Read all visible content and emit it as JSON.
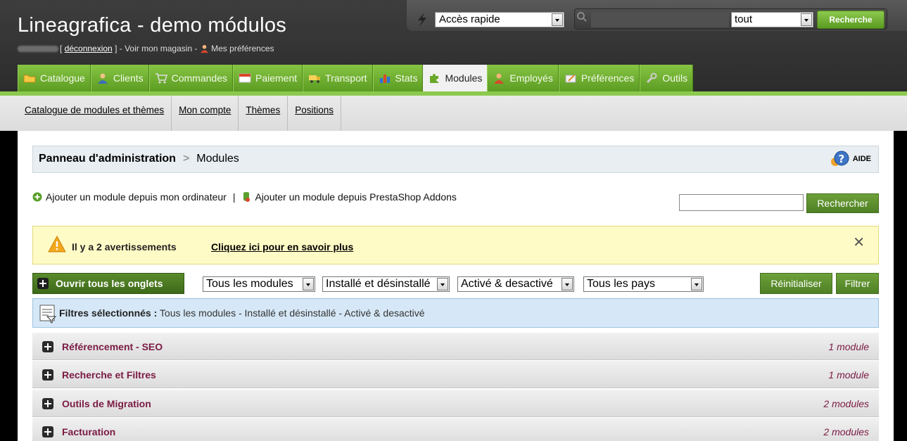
{
  "header": {
    "site_title": "Lineagrafica - demo módulos",
    "logout_link": "déconnexion",
    "shop_link": "] - Voir mon magasin -",
    "preferences_link": "Mes préférences",
    "quick_access": "Accès rapide",
    "search_scope": "tout",
    "search_button": "Recherche"
  },
  "tabs": [
    {
      "label": "Catalogue"
    },
    {
      "label": "Clients"
    },
    {
      "label": "Commandes"
    },
    {
      "label": "Paiement"
    },
    {
      "label": "Transport"
    },
    {
      "label": "Stats"
    },
    {
      "label": "Modules"
    },
    {
      "label": "Employés"
    },
    {
      "label": "Préférences"
    },
    {
      "label": "Outils"
    }
  ],
  "subnav": [
    {
      "label": "Catalogue de modules et thèmes"
    },
    {
      "label": "Mon compte"
    },
    {
      "label": "Thèmes"
    },
    {
      "label": "Positions"
    }
  ],
  "breadcrumb": {
    "root": "Panneau d'administration",
    "current": "Modules",
    "help": "AIDE"
  },
  "add_actions": {
    "from_computer": "Ajouter un module depuis mon ordinateur",
    "separator": "|",
    "from_addons": "Ajouter un module depuis PrestaShop Addons",
    "search_button": "Rechercher"
  },
  "warning": {
    "text": "Il y a 2 avertissements",
    "link": "Cliquez ici pour en savoir plus"
  },
  "toolbar": {
    "open_all": "Ouvrir tous les onglets",
    "filter_type": "Tous les modules",
    "filter_install": "Installé et désinstallé",
    "filter_active": "Activé & desactivé",
    "filter_country": "Tous les pays",
    "reset": "Réinitialiser",
    "apply": "Filtrer"
  },
  "selected_filters": {
    "label": "Filtres sélectionnés :",
    "value": "Tous les modules - Installé et désinstallé - Activé & desactivé"
  },
  "categories": [
    {
      "name": "Référencement - SEO",
      "count": "1 module"
    },
    {
      "name": "Recherche et Filtres",
      "count": "1 module"
    },
    {
      "name": "Outils de Migration",
      "count": "2 modules"
    },
    {
      "name": "Facturation",
      "count": "2 modules"
    }
  ],
  "colors": {
    "accent_green": "#8cc94f",
    "category_text": "#7a1b44",
    "warning_bg": "#fffbc6",
    "filters_bg": "#d6e8f7"
  }
}
